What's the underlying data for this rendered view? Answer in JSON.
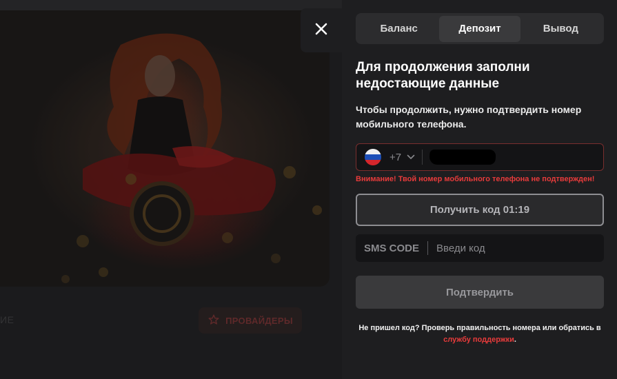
{
  "background": {
    "row_left_text": "ИЕ",
    "providers_button_label": "ПРОВАЙДЕРЫ",
    "providers_icon": "star-icon"
  },
  "modal": {
    "close_icon": "close-icon",
    "tabs": [
      {
        "label": "Баланс",
        "active": false
      },
      {
        "label": "Депозит",
        "active": true
      },
      {
        "label": "Вывод",
        "active": false
      }
    ],
    "title": "Для продолжения заполни недостающие данные",
    "subtitle": "Чтобы продолжить, нужно подтвердить номер мобильного телефона.",
    "phone": {
      "country_flag": "russia-flag-icon",
      "dial_code": "+7",
      "value_redacted": true
    },
    "warning": "Внимание! Твой номер мобильного телефона не подтвержден!",
    "get_code_button": "Получить код 01:19",
    "sms": {
      "label": "SMS CODE",
      "placeholder": "Введи код",
      "value": ""
    },
    "confirm_button": "Подтвердить",
    "help_text": "Не пришел код? Проверь правильность номера или обратись в",
    "help_link": "службу поддержки",
    "help_end": "."
  },
  "colors": {
    "panel_bg": "#1e1e20",
    "accent_red": "#e83b3b",
    "field_bg": "#141416"
  }
}
